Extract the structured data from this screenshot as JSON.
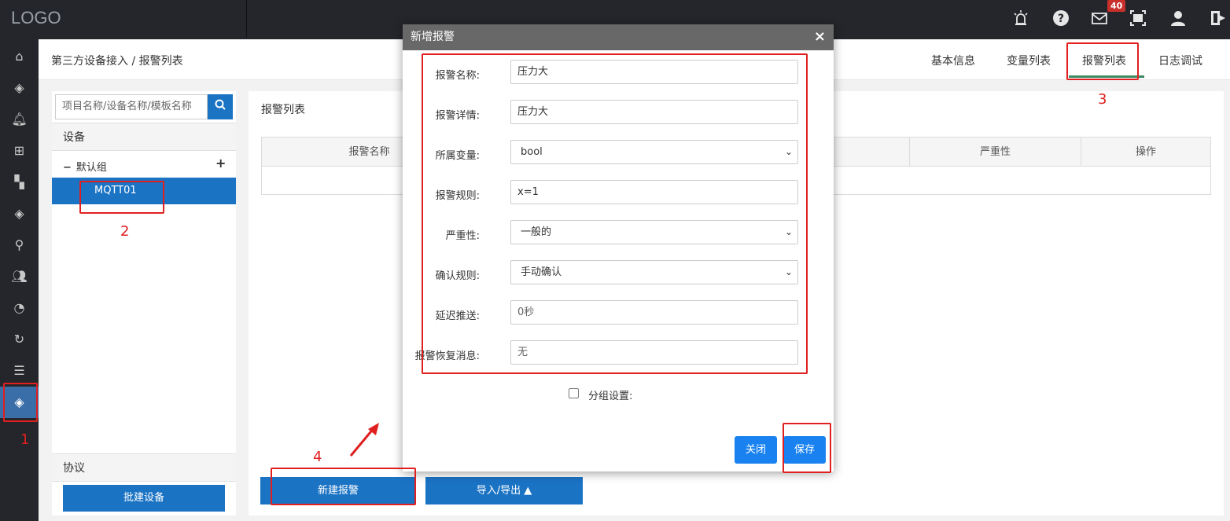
{
  "topbar": {
    "logo": "LOGO",
    "mail_count": "40",
    "icons": [
      "alarm-light-icon",
      "help-icon",
      "mail-icon",
      "fullscreen-icon",
      "user-icon",
      "logout-icon"
    ]
  },
  "sidenav": {
    "icons": [
      "home-icon",
      "layers-icon",
      "bell-icon",
      "add-box-icon",
      "dashboard-icon",
      "stack-icon",
      "location-icon",
      "group-icon",
      "gauge-icon",
      "cycle-icon",
      "list-icon",
      "layers-active-icon"
    ]
  },
  "header": {
    "breadcrumb": "第三方设备接入 / 报警列表",
    "tabs": [
      {
        "label": "基本信息"
      },
      {
        "label": "变量列表"
      },
      {
        "label": "报警列表",
        "active": true
      },
      {
        "label": "日志调试"
      }
    ]
  },
  "leftpanel": {
    "search_placeholder": "项目名称/设备名称/模板名称",
    "device_section": "设备",
    "group": "默认组",
    "device": "MQTT01",
    "protocol_section": "协议",
    "batch_button": "批建设备"
  },
  "main": {
    "title": "报警列表",
    "columns": [
      "报警名称",
      "严重性",
      "操作"
    ],
    "new_button": "新建报警",
    "io_button": "导入/导出 ▲"
  },
  "modal": {
    "title": "新增报警",
    "close": "×",
    "fields": [
      {
        "label": "报警名称:",
        "value": "压力大",
        "type": "text"
      },
      {
        "label": "报警详情:",
        "value": "压力大",
        "type": "text"
      },
      {
        "label": "所属变量:",
        "value": "bool",
        "type": "select"
      },
      {
        "label": "报警规则:",
        "value": "x=1",
        "type": "text"
      },
      {
        "label": "严重性:",
        "value": "一般的",
        "type": "select"
      },
      {
        "label": "确认规则:",
        "value": "手动确认",
        "type": "select"
      },
      {
        "label": "延迟推送:",
        "placeholder": "0秒",
        "type": "text"
      },
      {
        "label": "报警恢复消息:",
        "placeholder": "无",
        "type": "text"
      }
    ],
    "group_label": "分组设置:",
    "close_button": "关闭",
    "save_button": "保存"
  },
  "annotations": {
    "n1": "1",
    "n2": "2",
    "n3": "3",
    "n4": "4"
  },
  "colors": {
    "accent": "#1b73c4",
    "annotation": "#e02020",
    "tab_underline": "#3c8a63"
  }
}
